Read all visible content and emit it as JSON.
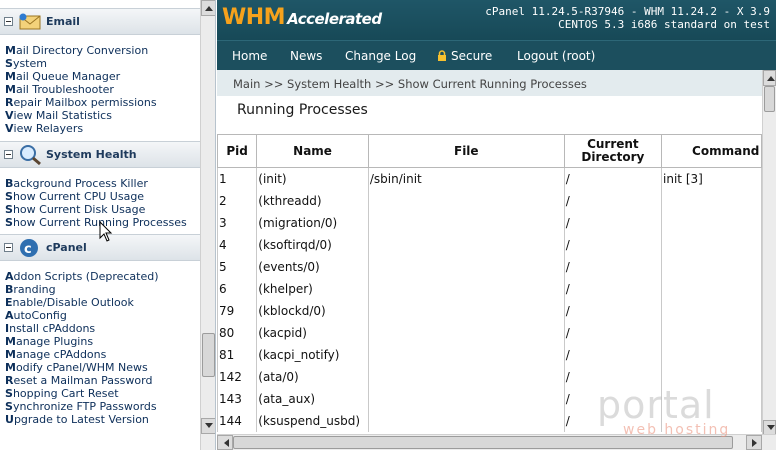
{
  "sidebar": {
    "email": {
      "title": "Email",
      "links": [
        "Mail Directory Conversion",
        "System",
        "Mail Queue Manager",
        "Mail Troubleshooter",
        "Repair Mailbox permissions",
        "View Mail Statistics",
        "View Relayers"
      ]
    },
    "system_health": {
      "title": "System Health",
      "links": [
        "Background Process Killer",
        "Show Current CPU Usage",
        "Show Current Disk Usage",
        "Show Current Running Processes"
      ]
    },
    "cpanel": {
      "title": "cPanel",
      "links": [
        "Addon Scripts (Deprecated)",
        "Branding",
        "Enable/Disable Outlook",
        "AutoConfig",
        "Install cPAddons",
        "Manage Plugins",
        "Manage cPAddons",
        "Modify cPanel/WHM News",
        "Reset a Mailman Password",
        "Shopping Cart Reset",
        "Synchronize FTP Passwords",
        "Upgrade to Latest Version"
      ]
    }
  },
  "header": {
    "logo_main": "WHM",
    "logo_accent": "Accelerated",
    "version_line1": "cPanel 11.24.5-R37946 - WHM 11.24.2 - X 3.9",
    "version_line2": "CENTOS 5.3 i686 standard on test"
  },
  "nav": {
    "home": "Home",
    "news": "News",
    "change_log": "Change Log",
    "secure": "Secure",
    "logout": "Logout (root)"
  },
  "breadcrumb": "Main >> System Health >> Show Current Running Processes",
  "page_title": "Running Processes",
  "table": {
    "columns": [
      "Pid",
      "Name",
      "File",
      "Current Directory",
      "Command"
    ],
    "rows": [
      [
        "1",
        "(init)",
        "/sbin/init",
        "/",
        "init [3]"
      ],
      [
        "2",
        "(kthreadd)",
        "",
        "/",
        ""
      ],
      [
        "3",
        "(migration/0)",
        "",
        "/",
        ""
      ],
      [
        "4",
        "(ksoftirqd/0)",
        "",
        "/",
        ""
      ],
      [
        "5",
        "(events/0)",
        "",
        "/",
        ""
      ],
      [
        "6",
        "(khelper)",
        "",
        "/",
        ""
      ],
      [
        "79",
        "(kblockd/0)",
        "",
        "/",
        ""
      ],
      [
        "80",
        "(kacpid)",
        "",
        "/",
        ""
      ],
      [
        "81",
        "(kacpi_notify)",
        "",
        "/",
        ""
      ],
      [
        "142",
        "(ata/0)",
        "",
        "/",
        ""
      ],
      [
        "143",
        "(ata_aux)",
        "",
        "/",
        ""
      ],
      [
        "144",
        "(ksuspend_usbd)",
        "",
        "/",
        ""
      ]
    ]
  },
  "watermark": {
    "brand": "portal",
    "sub": "web hosting"
  },
  "colors": {
    "banner": "#1f5667",
    "logo_orange": "#f6a21c",
    "nav_bg": "#1c4f5e",
    "crumb_bg": "#e3ebee",
    "link": "#0d2f5a"
  }
}
